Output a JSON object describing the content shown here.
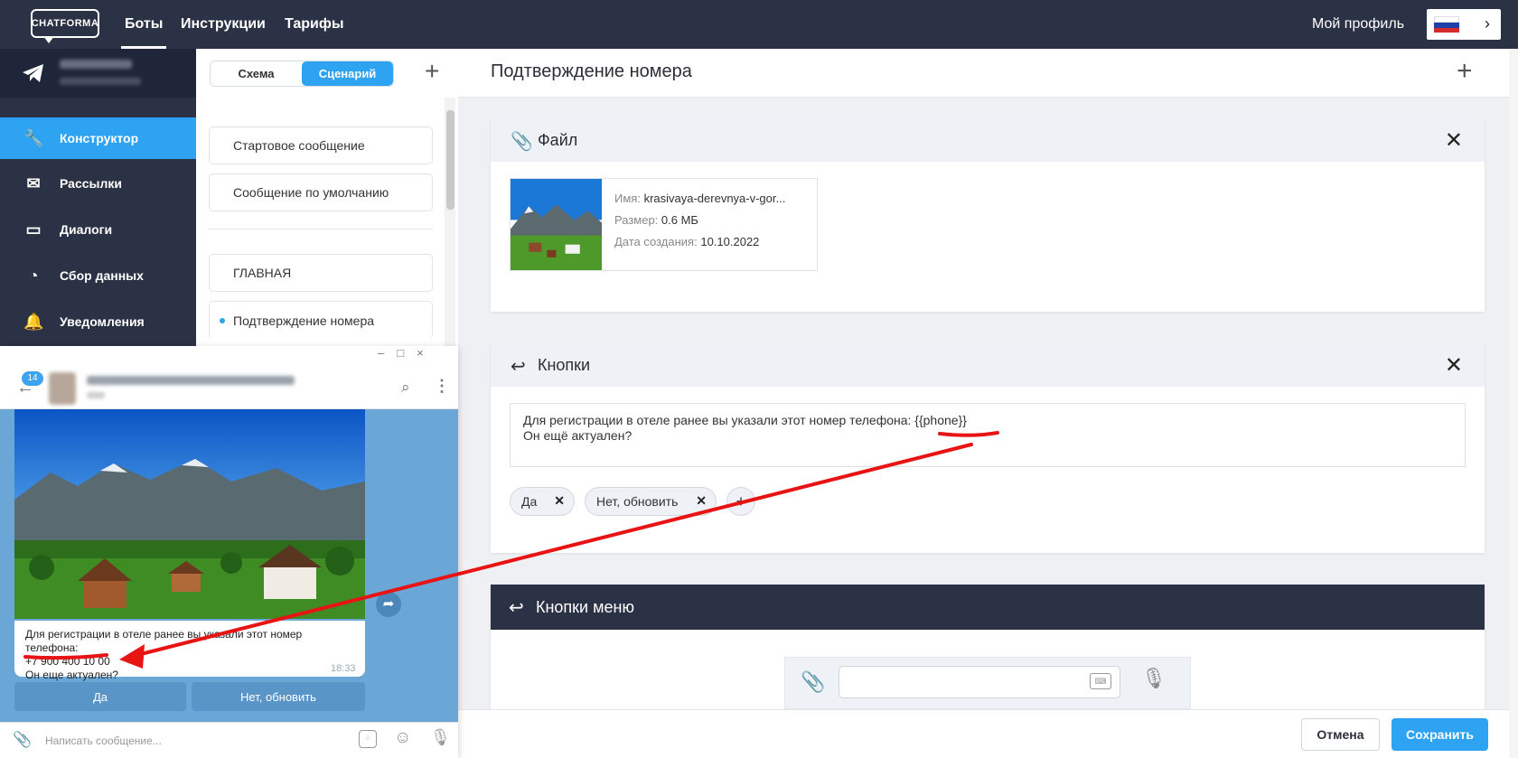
{
  "nav": {
    "logo": "CHATFORMA",
    "items": [
      "Боты",
      "Инструкции",
      "Тарифы"
    ],
    "profile": "Мой профиль",
    "lang_flag": "russia-flag-icon"
  },
  "sidebar": {
    "items": [
      {
        "label": "Конструктор",
        "icon": "wrench-icon"
      },
      {
        "label": "Рассылки",
        "icon": "envelope-icon"
      },
      {
        "label": "Диалоги",
        "icon": "chat-icon"
      },
      {
        "label": "Сбор данных",
        "icon": "chart-icon"
      },
      {
        "label": "Уведомления",
        "icon": "bell-icon"
      }
    ]
  },
  "scenario": {
    "toggle": {
      "scheme": "Схема",
      "scenario": "Сценарий"
    },
    "items": [
      "Стартовое сообщение",
      "Сообщение по умолчанию",
      "ГЛАВНАЯ",
      "Подтверждение номера"
    ]
  },
  "main": {
    "title": "Подтверждение номера",
    "file_card": {
      "title": "Файл",
      "name_label": "Имя:",
      "name": "krasivaya-derevnya-v-gor...",
      "size_label": "Размер:",
      "size": "0.6 МБ",
      "date_label": "Дата создания:",
      "date": "10.10.2022"
    },
    "buttons_card": {
      "title": "Кнопки",
      "message_line1": "Для регистрации в отеле ранее вы указали этот номер телефона: {{phone}}",
      "message_line2": "Он ещё актуален?",
      "chips": [
        "Да",
        "Нет, обновить"
      ],
      "add": "+"
    },
    "menu_card": {
      "title": "Кнопки меню"
    },
    "footer": {
      "cancel": "Отмена",
      "save": "Сохранить"
    }
  },
  "telegram": {
    "badge": "14",
    "message_line1": "Для регистрации в отеле ранее вы указали этот номер телефона:",
    "message_phone": "+7 900 400 10 00",
    "message_line3": "Он еще актуален?",
    "time": "18:33",
    "buttons": [
      "Да",
      "Нет, обновить"
    ],
    "input_placeholder": "Написать сообщение...",
    "window_controls": "–□×"
  },
  "colors": {
    "nav_bg": "#2c3245",
    "accent": "#2ea3f2",
    "annotation": "#e81313",
    "telegram_bg": "#6aa6d6"
  }
}
